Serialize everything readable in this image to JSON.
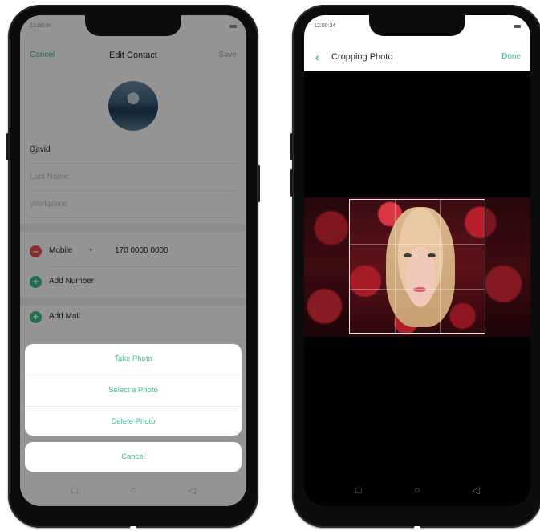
{
  "left_phone": {
    "status_time": "12:00:34",
    "nav": {
      "cancel": "Cancel",
      "title": "Edit Contact",
      "save": "Save"
    },
    "fields": {
      "first_name": "David",
      "last_name_placeholder": "Last Name",
      "workplace_placeholder": "Workplace"
    },
    "phone_row": {
      "label": "Mobile",
      "value": "170 0000 0000"
    },
    "add_number": "Add Number",
    "add_mail": "Add Mail",
    "action_sheet": {
      "take_photo": "Take Photo",
      "select_photo": "Select a Photo",
      "delete_photo": "Delete Photo"
    },
    "cancel": "Cancel"
  },
  "right_phone": {
    "status_time": "12:00:34",
    "title": "Cropping Photo",
    "done": "Done"
  },
  "colors": {
    "accent": "#3bbd87",
    "remove": "#e8504f"
  },
  "icons": [
    "back-chevron-icon",
    "remove-circle-icon",
    "add-circle-icon",
    "clear-icon",
    "nav-square-icon",
    "nav-circle-icon",
    "nav-back-triangle-icon"
  ]
}
